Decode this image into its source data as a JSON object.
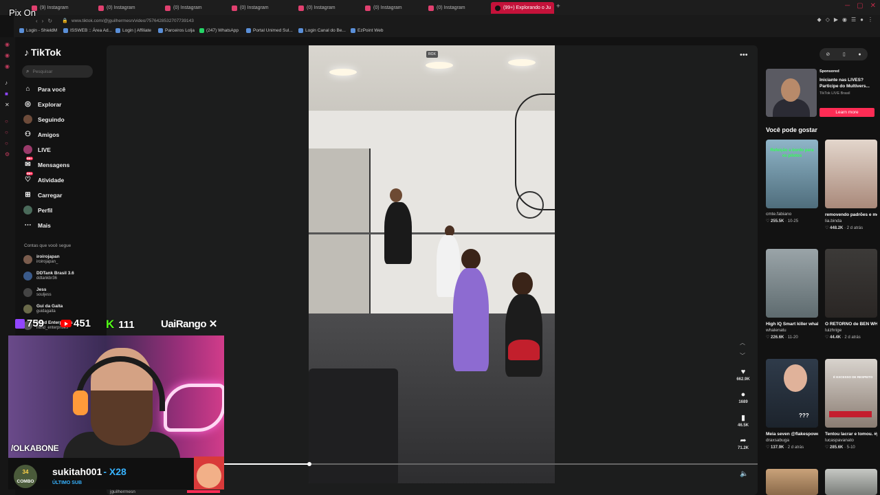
{
  "browser": {
    "tabs": [
      {
        "label": "(9) Instagram"
      },
      {
        "label": "(0) Instagram"
      },
      {
        "label": "(0) Instagram"
      },
      {
        "label": "(0) Instagram"
      },
      {
        "label": "(0) Instagram"
      },
      {
        "label": "(0) Instagram"
      },
      {
        "label": "(0) Instagram"
      },
      {
        "label": "(99+) Explorando o Ju"
      }
    ],
    "new_tab": "+",
    "url": "www.tiktok.com/@jguilhermesn/video/7576428532707739143",
    "bookmarks": [
      {
        "label": "Login - ShieldM"
      },
      {
        "label": "ISSWEB :: Área Ad..."
      },
      {
        "label": "Login | Affiliate"
      },
      {
        "label": "Parceiros Lolja"
      },
      {
        "label": "(247) WhatsApp"
      },
      {
        "label": "Portal Unimed Sul..."
      },
      {
        "label": "Login Canal do Be..."
      },
      {
        "label": "EzPoint Web"
      }
    ]
  },
  "tiktok": {
    "logo": "TikTok",
    "search_placeholder": "Pesquisar",
    "nav": [
      {
        "label": "Para você",
        "icon": "home-icon"
      },
      {
        "label": "Explorar",
        "icon": "compass-icon"
      },
      {
        "label": "Seguindo",
        "icon": "avatar-icon"
      },
      {
        "label": "Amigos",
        "icon": "friends-icon"
      },
      {
        "label": "LIVE",
        "icon": "live-icon"
      },
      {
        "label": "Mensagens",
        "icon": "messages-icon",
        "badge": "99+"
      },
      {
        "label": "Atividade",
        "icon": "activity-icon",
        "badge": "99+"
      },
      {
        "label": "Carregar",
        "icon": "upload-icon"
      },
      {
        "label": "Perfil",
        "icon": "profile-icon"
      },
      {
        "label": "Mais",
        "icon": "more-icon"
      }
    ],
    "following_title": "Contas que você segue",
    "following": [
      {
        "name": "iroirojapan",
        "handle": "iroirojapan_"
      },
      {
        "name": "DDTank Brasil 3.6",
        "handle": "ddtankbr36"
      },
      {
        "name": "Jess",
        "handle": "souljess"
      },
      {
        "name": "Gui da Gaita",
        "handle": "guidagaita"
      },
      {
        "name": "Mind Enterprises",
        "handle": "mind_enterprises"
      }
    ],
    "video_tag": "ROX",
    "actions": [
      {
        "icon": "heart-icon",
        "count": "662.9K"
      },
      {
        "icon": "comment-icon",
        "count": "1689"
      },
      {
        "icon": "bookmark-icon",
        "count": "46.5K"
      },
      {
        "icon": "share-icon",
        "count": "71.2K"
      }
    ],
    "progress": 0.16,
    "ad": {
      "sponsored": "Sponsored",
      "title": "Iniciante nas LIVES? Participe do Multivers...",
      "source": "TikTok LIVE Brasil",
      "cta": "Learn more"
    },
    "suggest_title": "Você pode gostar",
    "suggestions": [
      {
        "author": "cmte.fabiano",
        "title": "",
        "likes": "255.5K",
        "date": "10-25",
        "overlay": "Refeição a bordo para os pilotos"
      },
      {
        "author": "lia.binda",
        "title": "removendo padrões e moldando...",
        "likes": "448.2K",
        "date": "2 d atrás",
        "overlay": ""
      },
      {
        "author": "whalenatu",
        "title": "High IQ Smart killer whales can...",
        "likes": "226.6K",
        "date": "11-20",
        "overlay": ""
      },
      {
        "author": "luizhrige",
        "title": "O RETORNO de BEN WHITTAKER!...",
        "likes": "44.4K",
        "date": "2 d atrás",
        "overlay": ""
      },
      {
        "author": "draxsabuga",
        "title": "Meia seven @flakespower000...",
        "likes": "137.9K",
        "date": "2 d atrás",
        "overlay": "???"
      },
      {
        "author": "lucaspavanato",
        "title": "Tentou lacrar e tomou. #pavanato...",
        "likes": "285.6K",
        "date": "5-10",
        "overlay": "É EXCESSO DE RESPEITO"
      }
    ]
  },
  "stream": {
    "pix": "Pix On",
    "twitch_count": "759",
    "youtube_count": "451",
    "kick_count": "111",
    "sponsor": "UaiRango",
    "handle": "/OLKABONE",
    "combo_num": "34",
    "combo_label": "COMBO",
    "sub_name": "sukitah001",
    "sub_mult": "- X28",
    "sub_label": "ÚLTIMO SUB",
    "ghost_text": "jguilhermesn"
  },
  "colors": {
    "accent": "#fe2c55",
    "twitch": "#9146ff",
    "kick": "#53fc18",
    "youtube": "#ff0000"
  }
}
